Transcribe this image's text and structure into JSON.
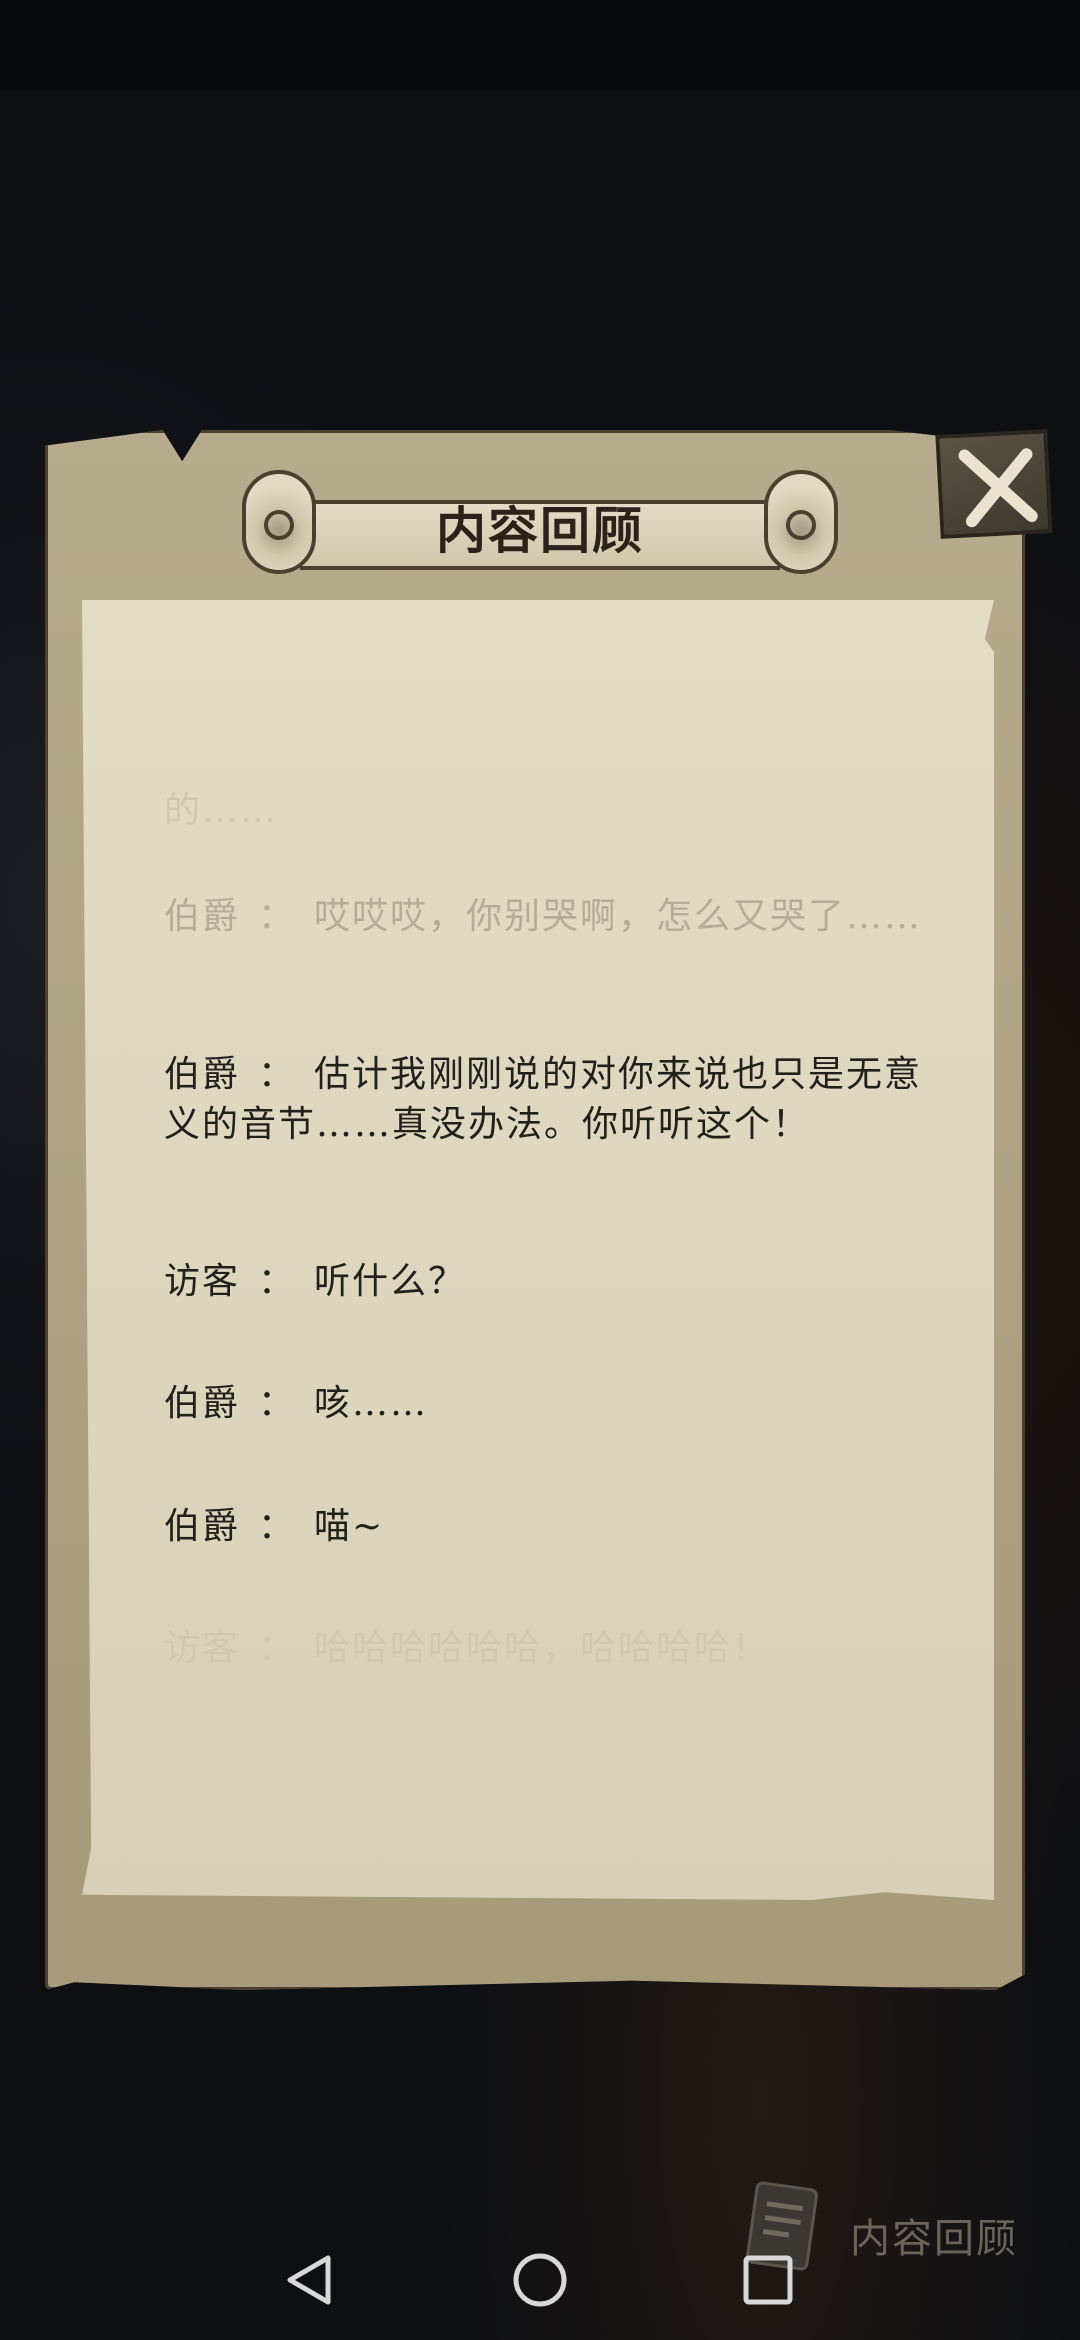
{
  "dialog": {
    "title": "内容回顾",
    "separator": "：",
    "lines": [
      {
        "speaker": "",
        "text": "的……",
        "style": "faint"
      },
      {
        "speaker": "伯爵",
        "text": "哎哎哎，你别哭啊，怎么又哭了……",
        "style": "faded"
      },
      {
        "speaker": "伯爵",
        "text": "估计我刚刚说的对你来说也只是无意义的音节……真没办法。你听听这个！",
        "style": "normal"
      },
      {
        "speaker": "访客",
        "text": "听什么？",
        "style": "normal"
      },
      {
        "speaker": "伯爵",
        "text": "咳……",
        "style": "normal"
      },
      {
        "speaker": "伯爵",
        "text": "喵~",
        "style": "normal"
      },
      {
        "speaker": "访客",
        "text": "哈哈哈哈哈哈，哈哈哈哈！",
        "style": "faint"
      }
    ]
  },
  "bottom_bar": {
    "review_label": "内容回顾"
  },
  "colors": {
    "parchment": "#b7ab8d",
    "paper": "#e2dcc5",
    "text": "#22201b",
    "background": "#0d0f13"
  },
  "icons": {
    "close": "close-x-icon",
    "review": "scroll-document-icon",
    "back": "back-triangle-icon",
    "home": "home-circle-icon",
    "recent": "recent-square-icon"
  }
}
